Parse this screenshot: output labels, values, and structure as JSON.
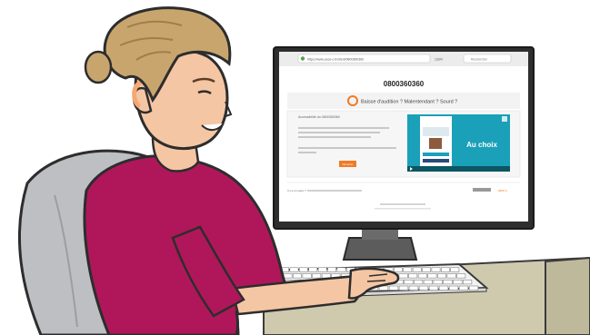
{
  "screen": {
    "url_bar": "https://www.acce-o.fr/client/0800360360",
    "zoom": "133%",
    "search_placeholder": "Rechercher",
    "phone_number": "0800360360",
    "banner_text": "Baisse d'audition ? Malentendant ? Sourd ?",
    "panel_title": "Accessibilité du 0800360360",
    "panel_cta": "Démarrer",
    "video_label": "Au choix",
    "footer_question": "Il y a un souci ?",
    "brand": "acce-o",
    "colors": {
      "accent_orange": "#f07b25",
      "video_blue": "#1aa0b8",
      "shirt_magenta": "#b0175a",
      "hair": "#c9a56e",
      "skin": "#f5c6a3",
      "chair": "#bdbfc2",
      "desk": "#cfc9ae"
    }
  }
}
